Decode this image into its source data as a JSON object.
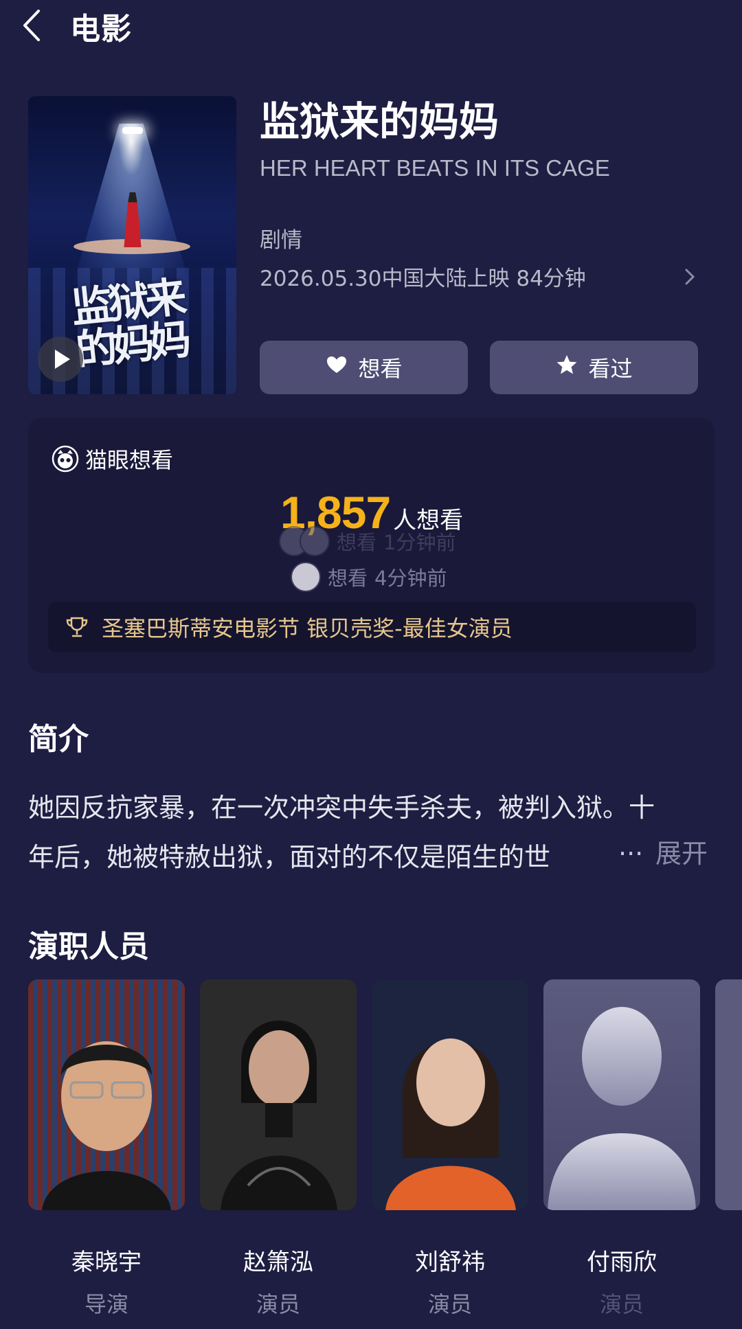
{
  "header": {
    "title": "电影"
  },
  "movie": {
    "title": "监狱来的妈妈",
    "english_title": "HER HEART BEATS IN ITS CAGE",
    "genre": "剧情",
    "release": "2026.05.30中国大陆上映 84分钟",
    "poster": {
      "calligraphy": "监狱来的妈妈",
      "english": "HER HEART BEATS IN ITS CAGE"
    }
  },
  "actions": {
    "want_label": "想看",
    "watched_label": "看过"
  },
  "maoyan": {
    "label": "猫眼想看",
    "count": "1,857",
    "count_unit": "人想看",
    "activity": [
      {
        "action": "想看",
        "time": "1分钟前"
      },
      {
        "action": "想看",
        "time": "4分钟前"
      }
    ],
    "award": "圣塞巴斯蒂安电影节 银贝壳奖-最佳女演员"
  },
  "intro": {
    "title": "简介",
    "line1": "她因反抗家暴，在一次冲突中失手杀夫，被判入狱。十",
    "line2": "年后，她被特赦出狱，面对的不仅是陌生的世",
    "ellipsis": "...",
    "expand": "展开"
  },
  "cast": {
    "title": "演职人员",
    "members": [
      {
        "name": "秦晓宇",
        "role": "导演"
      },
      {
        "name": "赵箫泓",
        "role": "演员"
      },
      {
        "name": "刘舒祎",
        "role": "演员"
      },
      {
        "name": "付雨欣",
        "role": "演员"
      }
    ]
  },
  "colors": {
    "background": "#1e1d42",
    "accent": "#f6b21a",
    "button": "#4f4d74",
    "award_text": "#e6c78c"
  }
}
